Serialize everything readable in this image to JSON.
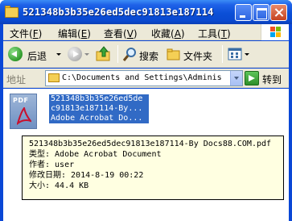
{
  "window": {
    "title": "521348b3b35e26ed5dec91813e187114"
  },
  "menu": {
    "items": [
      {
        "label": "文件",
        "key": "F"
      },
      {
        "label": "编辑",
        "key": "E"
      },
      {
        "label": "查看",
        "key": "V"
      },
      {
        "label": "收藏",
        "key": "A"
      },
      {
        "label": "工具",
        "key": "T"
      }
    ]
  },
  "toolbar": {
    "back_label": "后退",
    "search_label": "搜索",
    "folders_label": "文件夹"
  },
  "address": {
    "label": "地址",
    "value": "C:\\Documents and Settings\\Adminis",
    "go_label": "转到"
  },
  "file": {
    "icon": "pdf-file-icon",
    "icon_tag": "PDF",
    "name_lines": [
      "521348b3b35e26ed5de",
      "c91813e187114-By...",
      "Adobe Acrobat Do..."
    ]
  },
  "tooltip": {
    "lines": [
      "521348b3b35e26ed5dec91813e187114-By Docs88.COM.pdf",
      "类型: Adobe Acrobat Document",
      "作者: user",
      "修改日期: 2014-8-19 00:22",
      "大小: 44.4 KB"
    ]
  },
  "colors": {
    "titlebar": "#0b4fd7",
    "selection": "#316ac5",
    "tooltip_bg": "#ffffe1",
    "chrome_bg": "#ece9d8"
  }
}
